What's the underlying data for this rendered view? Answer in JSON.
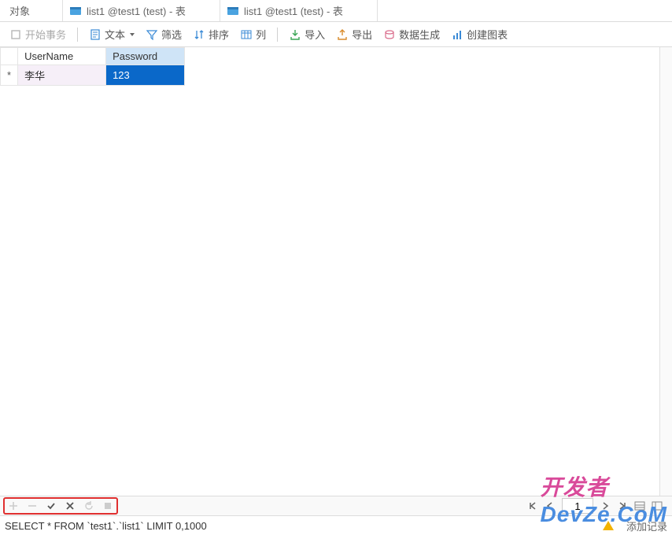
{
  "tabs": {
    "objects": "对象",
    "tab1": "list1 @test1 (test) - 表",
    "tab2": "list1 @test1 (test) - 表"
  },
  "toolbar": {
    "begin_transaction": "开始事务",
    "text": "文本",
    "filter": "筛选",
    "sort": "排序",
    "columns": "列",
    "import": "导入",
    "export": "导出",
    "data_gen": "数据生成",
    "create_chart": "创建图表"
  },
  "grid": {
    "columns": [
      "UserName",
      "Password"
    ],
    "rows": [
      {
        "indicator": "*",
        "UserName": "李华",
        "Password": "123"
      }
    ]
  },
  "pager": {
    "page": "1"
  },
  "status": {
    "sql": "SELECT * FROM `test1`.`list1` LIMIT 0,1000",
    "add_record": "添加记录"
  },
  "watermark": {
    "part1": "开发者",
    "part2": "DevZe.CoM"
  }
}
